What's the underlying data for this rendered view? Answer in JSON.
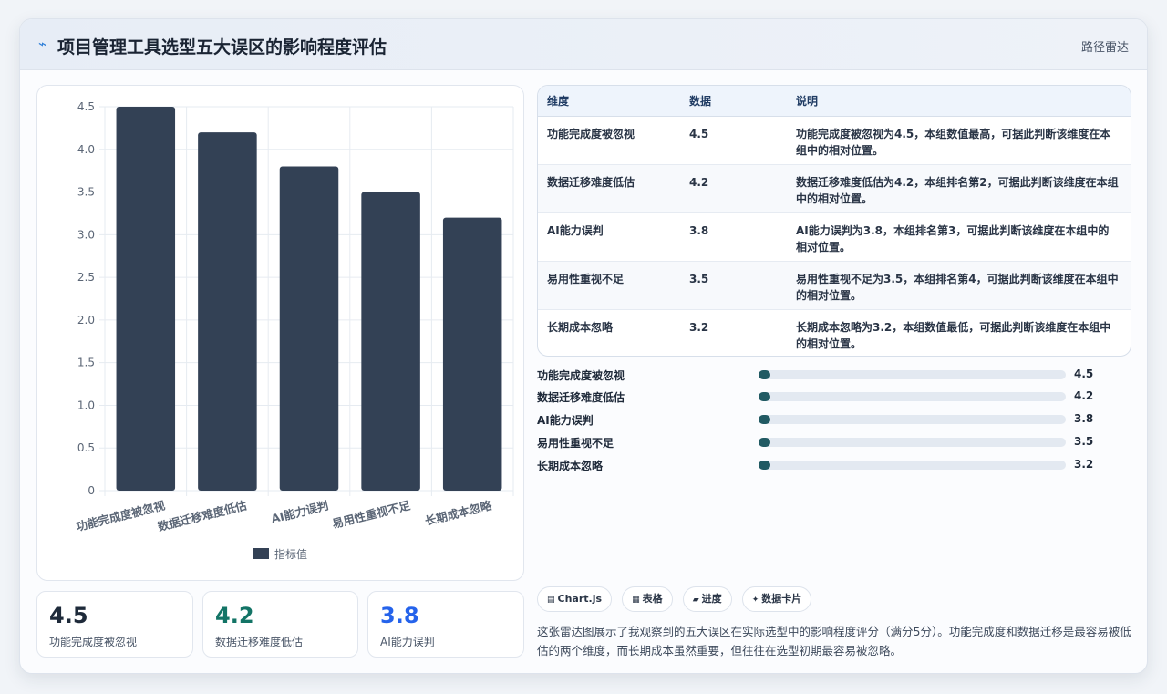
{
  "header": {
    "icon": "trend-line-icon",
    "title": "项目管理工具选型五大误区的影响程度评估",
    "tag": "路径雷达"
  },
  "chart_data": {
    "type": "bar",
    "categories": [
      "功能完成度被忽视",
      "数据迁移难度低估",
      "AI能力误判",
      "易用性重视不足",
      "长期成本忽略"
    ],
    "series": [
      {
        "name": "指标值",
        "values": [
          4.5,
          4.2,
          3.8,
          3.5,
          3.2
        ],
        "color": "#334155"
      }
    ],
    "yticks": [
      "0",
      "0.5",
      "1.0",
      "1.5",
      "2.0",
      "2.5",
      "3.0",
      "3.5",
      "4.0",
      "4.5"
    ],
    "ylim": [
      0,
      4.5
    ],
    "grid": true,
    "legend_position": "bottom"
  },
  "kpis": [
    {
      "value": "4.5",
      "label": "功能完成度被忽视",
      "color": "#1e2a3a"
    },
    {
      "value": "4.2",
      "label": "数据迁移难度低估",
      "color": "#137466"
    },
    {
      "value": "3.8",
      "label": "AI能力误判",
      "color": "#2563eb"
    }
  ],
  "table": {
    "headers": [
      "维度",
      "数据",
      "说明"
    ],
    "rows": [
      [
        "功能完成度被忽视",
        "4.5",
        "功能完成度被忽视为4.5，本组数值最高，可据此判断该维度在本组中的相对位置。"
      ],
      [
        "数据迁移难度低估",
        "4.2",
        "数据迁移难度低估为4.2，本组排名第2，可据此判断该维度在本组中的相对位置。"
      ],
      [
        "AI能力误判",
        "3.8",
        "AI能力误判为3.8，本组排名第3，可据此判断该维度在本组中的相对位置。"
      ],
      [
        "易用性重视不足",
        "3.5",
        "易用性重视不足为3.5，本组排名第4，可据此判断该维度在本组中的相对位置。"
      ],
      [
        "长期成本忽略",
        "3.2",
        "长期成本忽略为3.2，本组数值最低，可据此判断该维度在本组中的相对位置。"
      ]
    ]
  },
  "progress": [
    {
      "label": "功能完成度被忽视",
      "value": "4.5",
      "fill": 0.04
    },
    {
      "label": "数据迁移难度低估",
      "value": "4.2",
      "fill": 0.04
    },
    {
      "label": "AI能力误判",
      "value": "3.8",
      "fill": 0.04
    },
    {
      "label": "易用性重视不足",
      "value": "3.5",
      "fill": 0.04
    },
    {
      "label": "长期成本忽略",
      "value": "3.2",
      "fill": 0.04
    }
  ],
  "chips": [
    {
      "icon": "chart-icon",
      "glyph": "▤",
      "label": "Chart.js"
    },
    {
      "icon": "table-icon",
      "glyph": "▦",
      "label": "表格"
    },
    {
      "icon": "progress-icon",
      "glyph": "▰",
      "label": "进度"
    },
    {
      "icon": "card-icon",
      "glyph": "✦",
      "label": "数据卡片"
    }
  ],
  "summary": "这张雷达图展示了我观察到的五大误区在实际选型中的影响程度评分（满分5分）。功能完成度和数据迁移是最容易被低估的两个维度，而长期成本虽然重要，但往往在选型初期最容易被忽略。"
}
